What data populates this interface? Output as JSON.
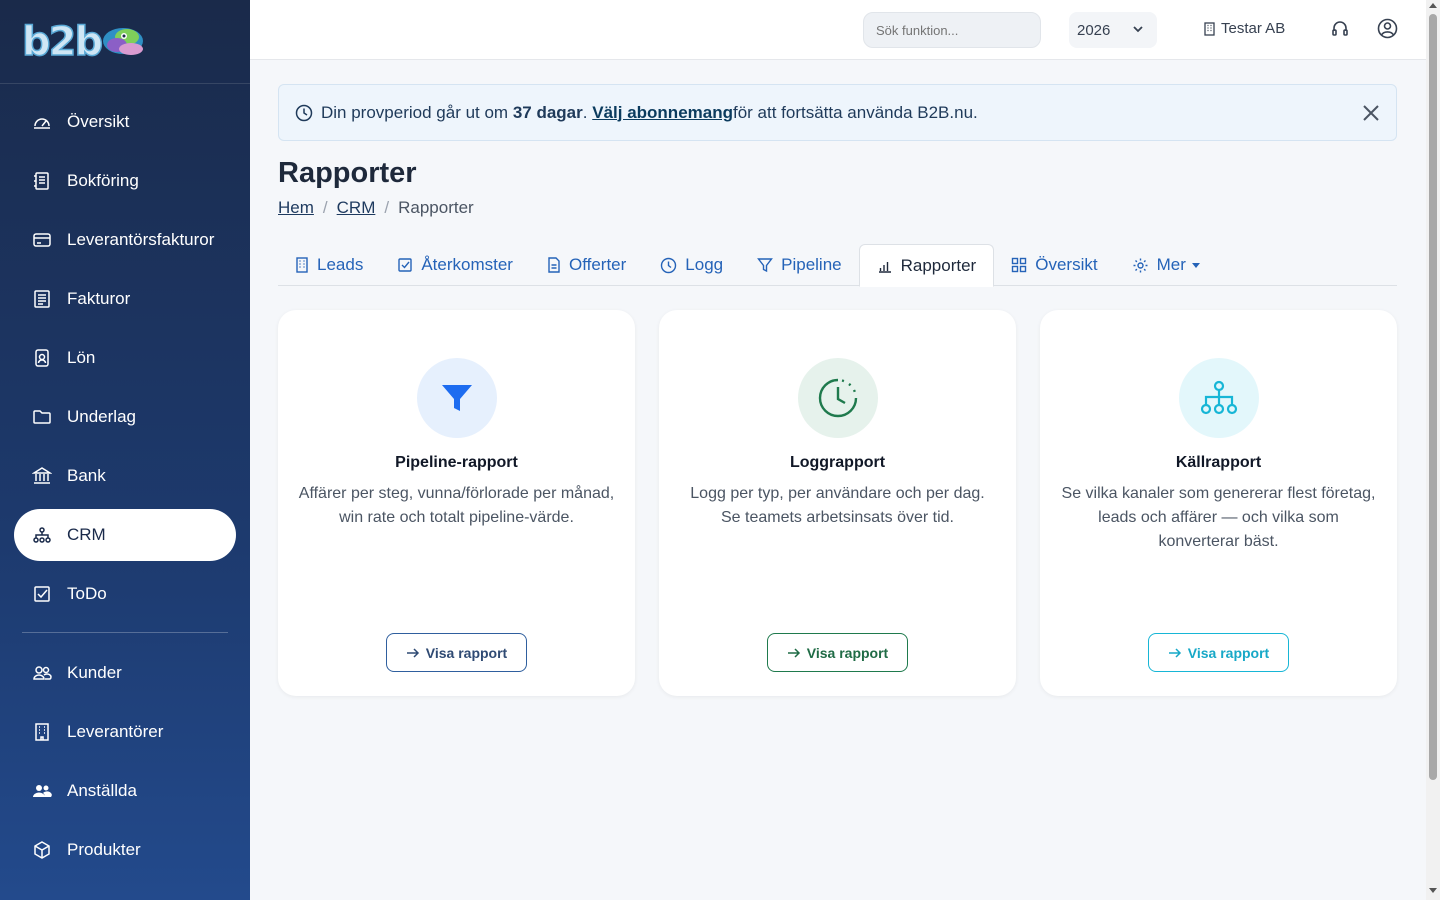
{
  "app": {
    "logo_text": "b2b"
  },
  "sidebar": {
    "items": [
      {
        "label": "Översikt",
        "icon": "gauge-icon"
      },
      {
        "label": "Bokföring",
        "icon": "ledger-icon"
      },
      {
        "label": "Leverantörsfakturor",
        "icon": "card-icon"
      },
      {
        "label": "Fakturor",
        "icon": "invoice-icon"
      },
      {
        "label": "Lön",
        "icon": "badge-icon"
      },
      {
        "label": "Underlag",
        "icon": "folder-icon"
      },
      {
        "label": "Bank",
        "icon": "bank-icon"
      },
      {
        "label": "CRM",
        "icon": "sitemap-icon",
        "active": true
      },
      {
        "label": "ToDo",
        "icon": "checkbox-icon"
      }
    ],
    "items2": [
      {
        "label": "Kunder",
        "icon": "people-icon"
      },
      {
        "label": "Leverantörer",
        "icon": "building-icon"
      },
      {
        "label": "Anställda",
        "icon": "people-fill-icon"
      },
      {
        "label": "Produkter",
        "icon": "box-icon"
      }
    ]
  },
  "topbar": {
    "search_placeholder": "Sök funktion...",
    "year": "2026",
    "company": "Testar AB"
  },
  "alert": {
    "pre": "Din provperiod går ut om ",
    "days": "37 dagar",
    "dot": ". ",
    "link": "Välj abonnemang",
    "post": " för att fortsätta använda B2B.nu."
  },
  "page": {
    "title": "Rapporter",
    "breadcrumb": [
      "Hem",
      "CRM",
      "Rapporter"
    ]
  },
  "tabs": [
    {
      "label": "Leads",
      "icon": "building-icon"
    },
    {
      "label": "Återkomster",
      "icon": "checkbox-icon"
    },
    {
      "label": "Offerter",
      "icon": "document-icon"
    },
    {
      "label": "Logg",
      "icon": "clock-icon"
    },
    {
      "label": "Pipeline",
      "icon": "filter-icon"
    },
    {
      "label": "Rapporter",
      "icon": "bar-chart-icon",
      "active": true
    },
    {
      "label": "Översikt",
      "icon": "grid-icon"
    },
    {
      "label": "Mer",
      "icon": "gear-icon",
      "dropdown": true
    }
  ],
  "cards": [
    {
      "title": "Pipeline-rapport",
      "desc": "Affärer per steg, vunna/förlorade per månad, win rate och totalt pipeline-värde.",
      "button": "Visa rapport",
      "icon": "funnel-icon",
      "accent": "#1d6cf0",
      "bg": "#e6f0fd",
      "border": "#2f5f9e"
    },
    {
      "title": "Loggrapport",
      "desc": "Logg per typ, per användare och per dag. Se teamets arbetsinsats över tid.",
      "button": "Visa rapport",
      "icon": "clock-history-icon",
      "accent": "#1f7a4d",
      "bg": "#e6f2ec",
      "border": "#1f7a4d"
    },
    {
      "title": "Källrapport",
      "desc": "Se vilka kanaler som genererar flest företag, leads och affärer — och vilka som konverterar bäst.",
      "button": "Visa rapport",
      "icon": "diagram-icon",
      "accent": "#17b6d6",
      "bg": "#e3f7fb",
      "border": "#17b6d6"
    }
  ]
}
